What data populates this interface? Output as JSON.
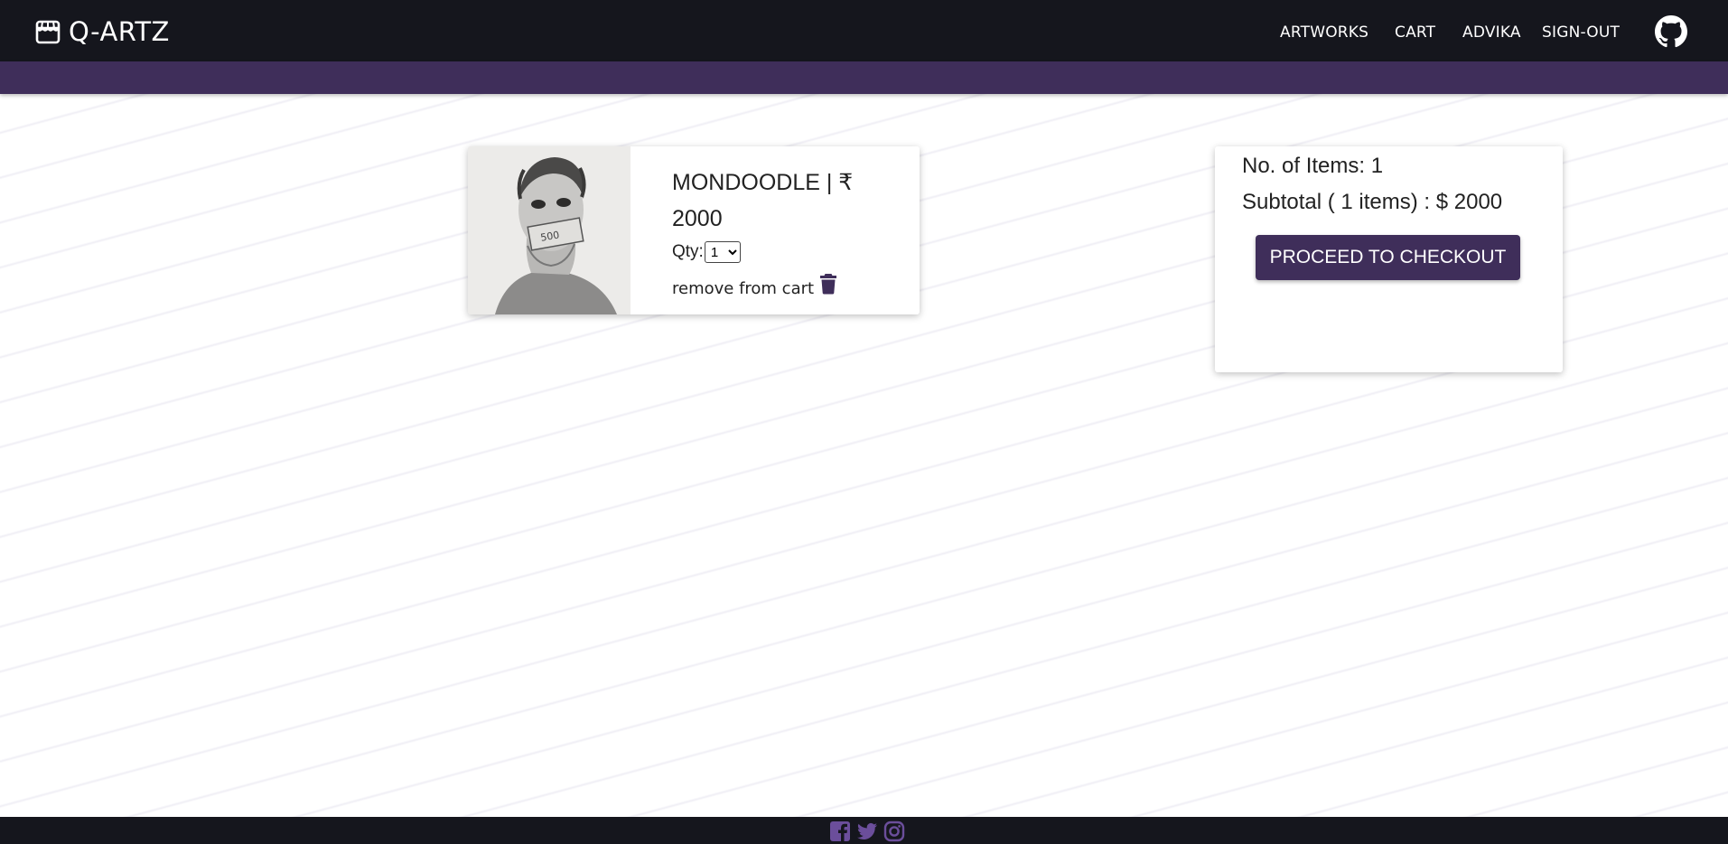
{
  "navbar": {
    "brand": "Q-ARTZ",
    "links": [
      "ARTWORKS",
      "CART",
      "ADVIKA",
      "SIGN-OUT"
    ]
  },
  "cart": {
    "item_title": "MONDOODLE | ₹ 2000",
    "qty_label": "Qty:",
    "qty_value": "1",
    "remove_label": "remove from cart"
  },
  "summary": {
    "items_line": "No. of Items: 1",
    "subtotal_line": "Subtotal ( 1 items) : $ 2000",
    "checkout_label": "PROCEED TO CHECKOUT"
  },
  "colors": {
    "navbar": "#15161d",
    "accent": "#3f2e5a",
    "social_icons": "#6b4e9b"
  },
  "icons": {
    "brand": "storefront-icon",
    "github": "github-icon",
    "trash": "trash-icon",
    "social": [
      "facebook-icon",
      "twitter-icon",
      "instagram-icon"
    ]
  }
}
